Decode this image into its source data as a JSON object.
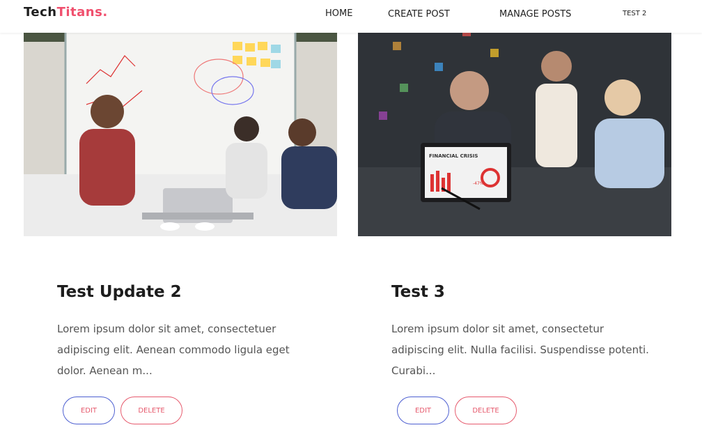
{
  "brand": {
    "name_part1": "Tech",
    "name_part2": "Titans."
  },
  "nav": {
    "home": "HOME",
    "create_post": "CREATE POST",
    "manage_posts": "MANAGE POSTS",
    "test2": "TEST 2"
  },
  "posts": [
    {
      "title": "Test Update 2",
      "excerpt": "Lorem ipsum dolor sit amet, consectetuer adipiscing elit. Aenean commodo ligula eget dolor. Aenean m...",
      "edit_label": "EDIT",
      "delete_label": "DELETE"
    },
    {
      "title": "Test 3",
      "excerpt": "Lorem ipsum dolor sit amet, consectetur adipiscing elit. Nulla facilisi. Suspendisse potenti. Curabi...",
      "edit_label": "EDIT",
      "delete_label": "DELETE",
      "image_text": "FINANCIAL CRISIS",
      "image_percent": "-47%"
    }
  ],
  "colors": {
    "accent": "#f0506e",
    "button_border": "#4d5fd1",
    "button_text": "#e65a6d"
  }
}
